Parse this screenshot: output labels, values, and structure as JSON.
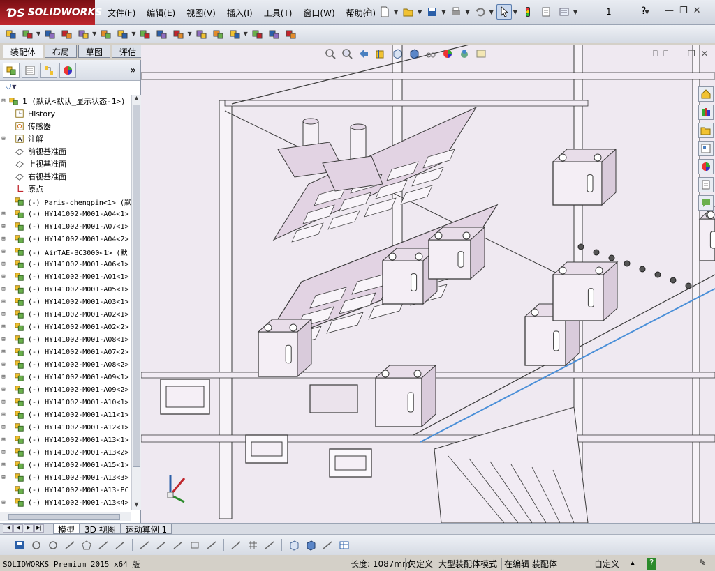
{
  "app": {
    "logo": "SOLIDWORKS",
    "menu": [
      "文件(F)",
      "编辑(E)",
      "视图(V)",
      "插入(I)",
      "工具(T)",
      "窗口(W)",
      "帮助(H)"
    ],
    "toolbar_number": "1",
    "help_symbol": "?"
  },
  "command_tabs": [
    "装配体",
    "布局",
    "草图",
    "评估"
  ],
  "active_command_tab": "装配体",
  "feature_manager": {
    "expand_symbol": "»",
    "filter_symbol": "▼",
    "tree": [
      {
        "label": "1  (默认<默认_显示状态-1>)",
        "type": "root",
        "expand": "⊟"
      },
      {
        "label": "History",
        "type": "history"
      },
      {
        "label": "传感器",
        "type": "sensor"
      },
      {
        "label": "注解",
        "type": "annotation",
        "expand": "⊞"
      },
      {
        "label": "前视基准面",
        "type": "plane"
      },
      {
        "label": "上视基准面",
        "type": "plane"
      },
      {
        "label": "右视基准面",
        "type": "plane"
      },
      {
        "label": "原点",
        "type": "origin"
      },
      {
        "label": "(-) Paris-chengpin<1> (默",
        "type": "part"
      },
      {
        "label": "(-) HY141002-M001-A04<1>",
        "type": "part",
        "expand": "⊞"
      },
      {
        "label": "(-) HY141002-M001-A07<1>",
        "type": "part",
        "expand": "⊞"
      },
      {
        "label": "(-) HY141002-M001-A04<2>",
        "type": "part",
        "expand": "⊞"
      },
      {
        "label": "(-) AirTAE-BC3000<1> (默",
        "type": "part",
        "expand": "⊞"
      },
      {
        "label": "(-) HY141002-M001-A06<1>",
        "type": "part",
        "expand": "⊞"
      },
      {
        "label": "(-) HY141002-M001-A01<1>",
        "type": "part",
        "expand": "⊞"
      },
      {
        "label": "(-) HY141002-M001-A05<1>",
        "type": "part",
        "expand": "⊞"
      },
      {
        "label": "(-) HY141002-M001-A03<1>",
        "type": "part",
        "expand": "⊞"
      },
      {
        "label": "(-) HY141002-M001-A02<1>",
        "type": "part",
        "expand": "⊞"
      },
      {
        "label": "(-) HY141002-M001-A02<2>",
        "type": "part",
        "expand": "⊞"
      },
      {
        "label": "(-) HY141002-M001-A08<1>",
        "type": "part",
        "expand": "⊞"
      },
      {
        "label": "(-) HY141002-M001-A07<2>",
        "type": "part",
        "expand": "⊞"
      },
      {
        "label": "(-) HY141002-M001-A08<2>",
        "type": "part",
        "expand": "⊞"
      },
      {
        "label": "(-) HY141002-M001-A09<1>",
        "type": "part",
        "expand": "⊞"
      },
      {
        "label": "(-) HY141002-M001-A09<2>",
        "type": "part",
        "expand": "⊞"
      },
      {
        "label": "(-) HY141002-M001-A10<1>",
        "type": "part",
        "expand": "⊞"
      },
      {
        "label": "(-) HY141002-M001-A11<1>",
        "type": "part",
        "expand": "⊞"
      },
      {
        "label": "(-) HY141002-M001-A12<1>",
        "type": "part",
        "expand": "⊞"
      },
      {
        "label": "(-) HY141002-M001-A13<1>",
        "type": "part",
        "expand": "⊞"
      },
      {
        "label": "(-) HY141002-M001-A13<2>",
        "type": "part",
        "expand": "⊞"
      },
      {
        "label": "(-) HY141002-M001-A15<1>",
        "type": "part",
        "expand": "⊞"
      },
      {
        "label": "(-) HY141002-M001-A13<3>",
        "type": "part",
        "expand": "⊞"
      },
      {
        "label": "(-) HY141002-M001-A13-PC",
        "type": "part"
      },
      {
        "label": "(-) HY141002-M001-A13<4>",
        "type": "part",
        "expand": "⊞"
      }
    ]
  },
  "view_tabs": [
    "模型",
    "3D 视图",
    "运动算例 1"
  ],
  "active_view_tab": "模型",
  "status": {
    "product": "SOLIDWORKS Premium 2015 x64 版",
    "length": "长度: 1087mm",
    "underdefined": "欠定义",
    "mode": "大型装配体模式",
    "editing": "在编辑 装配体",
    "units": "自定义",
    "help_symbol": "?"
  },
  "colors": {
    "accent": "#c0262d",
    "model_tint": "#e2d3e3",
    "model_edge": "#3a3a3a",
    "selection": "#4a8fd8"
  }
}
